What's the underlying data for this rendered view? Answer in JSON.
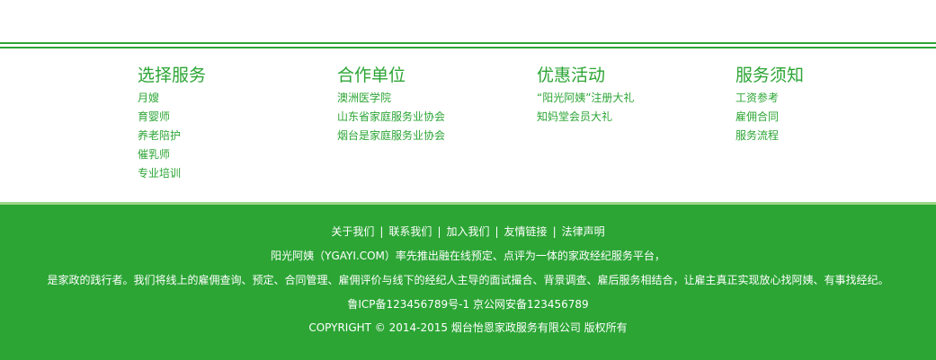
{
  "columns": [
    {
      "title": "选择服务",
      "items": [
        "月嫂",
        "育婴师",
        "养老陪护",
        "催乳师",
        "专业培训"
      ]
    },
    {
      "title": "合作单位",
      "items": [
        "澳洲医学院",
        "山东省家庭服务业协会",
        "烟台是家庭服务业协会"
      ]
    },
    {
      "title": "优惠活动",
      "items": [
        "“阳光阿姨”注册大礼",
        "知妈堂会员大礼"
      ]
    },
    {
      "title": "服务须知",
      "items": [
        "工资参考",
        "雇佣合同",
        "服务流程"
      ]
    }
  ],
  "footer": {
    "nav": [
      "关于我们",
      "联系我们",
      "加入我们",
      "友情链接",
      "法律声明"
    ],
    "separator": "|",
    "intro_line1": "阳光阿姨（YGAYI.COM）率先推出融在线预定、点评为一体的家政经纪服务平台，",
    "intro_line2": "是家政的践行者。我们将线上的雇佣查询、预定、合同管理、雇佣评价与线下的经纪人主导的面试撮合、背景调查、雇后服务相结合，让雇主真正实现放心找阿姨、有事找经纪。",
    "icp": "鲁ICP备123456789号-1 京公网安备123456789",
    "copyright": "COPYRIGHT © 2014-2015 烟台怡恩家政服务有限公司 版权所有"
  },
  "colors": {
    "brand_green": "#2ca535",
    "footer_border": "#9fd686",
    "footer_text": "#ffffff"
  }
}
